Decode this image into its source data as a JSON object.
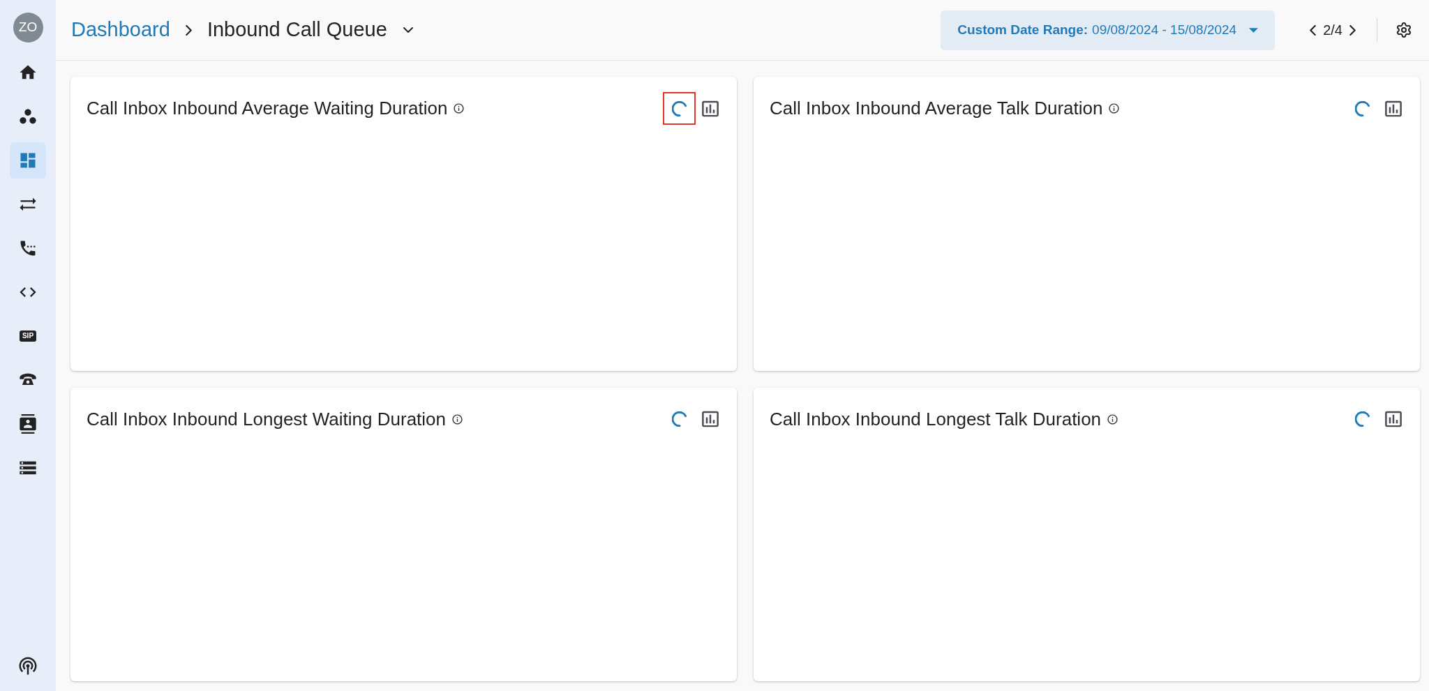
{
  "user": {
    "initials": "ZO"
  },
  "nav": [
    {
      "kind": "home",
      "selected": false
    },
    {
      "kind": "groups",
      "selected": false
    },
    {
      "kind": "dashboard",
      "selected": true
    },
    {
      "kind": "transfer",
      "selected": false
    },
    {
      "kind": "phone-dots",
      "selected": false
    },
    {
      "kind": "code",
      "selected": false
    },
    {
      "kind": "badge",
      "label": "SIP",
      "selected": false
    },
    {
      "kind": "desk-phone",
      "selected": false
    },
    {
      "kind": "contact",
      "selected": false
    },
    {
      "kind": "storage",
      "selected": false
    }
  ],
  "nav_bottom": {
    "kind": "antenna"
  },
  "breadcrumb": {
    "root": "Dashboard",
    "current": "Inbound Call Queue"
  },
  "date_range": {
    "label": "Custom Date Range:",
    "value": "09/08/2024 - 15/08/2024"
  },
  "pager": {
    "text": "2/4"
  },
  "cards": [
    {
      "title": "Call Inbox Inbound Average Waiting Duration",
      "loading": true,
      "highlighted": true
    },
    {
      "title": "Call Inbox Inbound Average Talk Duration",
      "loading": true,
      "highlighted": false
    },
    {
      "title": "Call Inbox Inbound Longest Waiting Duration",
      "loading": true,
      "highlighted": false
    },
    {
      "title": "Call Inbox Inbound Longest Talk Duration",
      "loading": true,
      "highlighted": false
    }
  ]
}
